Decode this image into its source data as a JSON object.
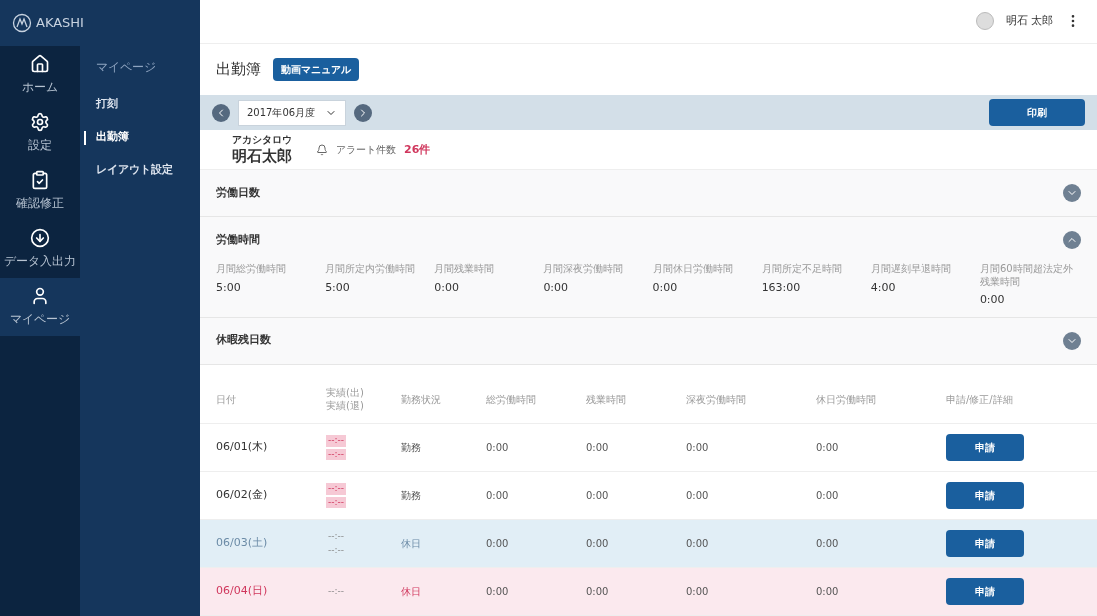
{
  "brand": "AKASHI",
  "nav": [
    {
      "label": "ホーム",
      "selected": false
    },
    {
      "label": "設定",
      "selected": false
    },
    {
      "label": "確認修正",
      "selected": false
    },
    {
      "label": "データ入出力",
      "selected": false
    },
    {
      "label": "マイページ",
      "selected": true
    }
  ],
  "submenu": {
    "heading": "マイページ",
    "items": [
      {
        "label": "打刻",
        "selected": false
      },
      {
        "label": "出勤簿",
        "selected": true
      },
      {
        "label": "レイアウト設定",
        "selected": false
      }
    ]
  },
  "user": {
    "name": "明石 太郎"
  },
  "page": {
    "title": "出勤簿",
    "manual_button": "動画マニュアル"
  },
  "period": {
    "value": "2017年06月度",
    "print_button": "印刷"
  },
  "employee": {
    "furigana": "アカシタロウ",
    "name": "明石太郎",
    "alert_label": "アラート件数",
    "alert_count": "26件"
  },
  "sections": [
    {
      "title": "労働日数",
      "expanded": false
    },
    {
      "title": "労働時間",
      "expanded": true,
      "metrics": [
        {
          "label": "月間総労働時間",
          "value": "5:00"
        },
        {
          "label": "月間所定内労働時間",
          "value": "5:00"
        },
        {
          "label": "月間残業時間",
          "value": "0:00"
        },
        {
          "label": "月間深夜労働時間",
          "value": "0:00"
        },
        {
          "label": "月間休日労働時間",
          "value": "0:00"
        },
        {
          "label": "月間所定不足時間",
          "value": "163:00"
        },
        {
          "label": "月間遅刻早退時間",
          "value": "4:00"
        },
        {
          "label": "月間60時間超法定外残業時間",
          "value": "0:00"
        }
      ]
    },
    {
      "title": "休暇残日数",
      "expanded": false
    }
  ],
  "table": {
    "columns": [
      "日付",
      "実績(出)\n実績(退)",
      "勤務状況",
      "総労働時間",
      "残業時間",
      "深夜労働時間",
      "休日労働時間",
      "申請/修正/詳細"
    ],
    "rows": [
      {
        "kind": "weekday",
        "date": "06/01(木)",
        "in": "--:--",
        "out": "--:--",
        "missing": true,
        "status": "勤務",
        "total": "0:00",
        "overtime": "0:00",
        "night": "0:00",
        "holiday": "0:00",
        "button": "申請"
      },
      {
        "kind": "weekday",
        "date": "06/02(金)",
        "in": "--:--",
        "out": "--:--",
        "missing": true,
        "status": "勤務",
        "total": "0:00",
        "overtime": "0:00",
        "night": "0:00",
        "holiday": "0:00",
        "button": "申請"
      },
      {
        "kind": "saturday",
        "date": "06/03(土)",
        "in": "--:--",
        "out": "--:--",
        "missing": false,
        "status": "休日",
        "total": "0:00",
        "overtime": "0:00",
        "night": "0:00",
        "holiday": "0:00",
        "button": "申請"
      },
      {
        "kind": "sunday",
        "date": "06/04(日)",
        "in": "--:--",
        "missing": false,
        "status": "休日",
        "total": "0:00",
        "overtime": "0:00",
        "night": "0:00",
        "holiday": "0:00",
        "button": "申請"
      }
    ]
  }
}
